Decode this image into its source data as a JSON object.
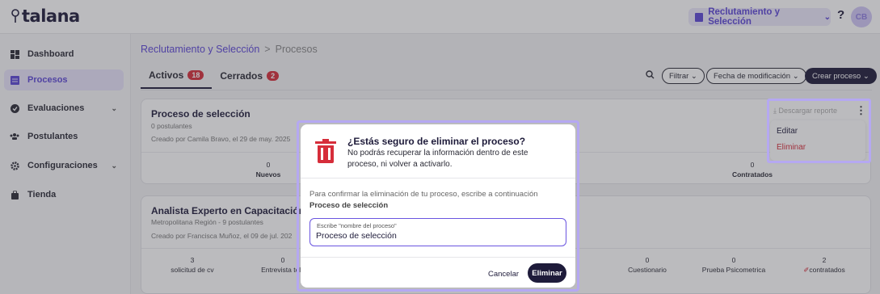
{
  "app": {
    "logo_text": "talana"
  },
  "topbar": {
    "module": "Reclutamiento y Selección",
    "help": "?",
    "avatar_initials": "CB"
  },
  "sidebar": {
    "items": [
      {
        "label": "Dashboard",
        "icon": "dashboard-icon"
      },
      {
        "label": "Procesos",
        "icon": "list-icon",
        "active": true
      },
      {
        "label": "Evaluaciones",
        "icon": "check-circle-icon"
      },
      {
        "label": "Postulantes",
        "icon": "people-icon"
      },
      {
        "label": "Configuraciones",
        "icon": "gear-icon"
      },
      {
        "label": "Tienda",
        "icon": "bag-icon"
      }
    ]
  },
  "breadcrumb": {
    "parent": "Reclutamiento y Selección",
    "separator": ">",
    "current": "Procesos"
  },
  "tabs": [
    {
      "label": "Activos",
      "count": "18"
    },
    {
      "label": "Cerrados",
      "count": "2"
    }
  ],
  "toolbar": {
    "filter": "Filtrar",
    "sort": "Fecha de modificación",
    "create": "Crear proceso"
  },
  "card1": {
    "title": "Proceso de selección",
    "postulants": "0 postulantes",
    "created": "Creado por Camila Bravo, el 29 de may. 2025",
    "stats": [
      {
        "value": "0",
        "label": "Nuevos"
      },
      {
        "value": "0",
        "label": "Contratados"
      }
    ],
    "download": "Descargar reporte",
    "menu": {
      "edit": "Editar",
      "delete": "Eliminar"
    }
  },
  "card2": {
    "title": "Analista Experto en Capacitación",
    "location": "Metropolitana Región - 9 postulantes",
    "created": "Creado por Francisca Muñoz, el 09 de jul. 202",
    "stats": [
      {
        "value": "3",
        "label": "solicitud de cv"
      },
      {
        "value": "0",
        "label": "Entrevista tele"
      },
      {
        "value": "0",
        "label": "Cuestionario"
      },
      {
        "value": "0",
        "label": "Prueba Psicometrica"
      },
      {
        "value": "2",
        "label": "contratados"
      }
    ]
  },
  "modal": {
    "title": "¿Estás seguro de eliminar el proceso?",
    "description": "No podrás recuperar la información dentro de este proceso, ni volver a activarlo.",
    "confirm_text": "Para confirmar la eliminación de tu proceso, escribe a continuación",
    "confirm_name": "Proceso de selección",
    "field_label": "Escribe \"nombre del proceso\"",
    "field_value": "Proceso de selección",
    "cancel": "Cancelar",
    "delete": "Eliminar"
  },
  "colors": {
    "accent": "#5b45d6",
    "danger": "#d62d3a",
    "dark": "#1e1b3a",
    "highlight": "#b5a8f2"
  }
}
